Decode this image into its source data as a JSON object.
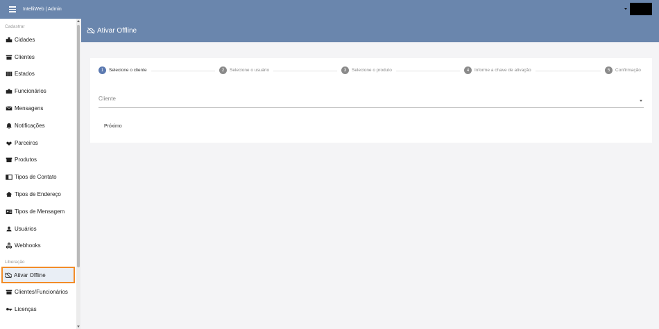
{
  "topbar": {
    "app_title": "IntelliWeb | Admin"
  },
  "sidebar": {
    "section_cadastrar": "Cadastrar",
    "items_cadastrar": [
      {
        "label": "Cidades",
        "icon": "city-icon"
      },
      {
        "label": "Clientes",
        "icon": "store-icon"
      },
      {
        "label": "Estados",
        "icon": "map-icon"
      },
      {
        "label": "Funcionários",
        "icon": "briefcase-icon"
      },
      {
        "label": "Mensagens",
        "icon": "mail-icon"
      },
      {
        "label": "Notificações",
        "icon": "bell-icon"
      },
      {
        "label": "Parceiros",
        "icon": "handshake-icon"
      },
      {
        "label": "Produtos",
        "icon": "box-icon"
      },
      {
        "label": "Tipos de Contato",
        "icon": "contact-icon"
      },
      {
        "label": "Tipos de Endereço",
        "icon": "home-icon"
      },
      {
        "label": "Tipos de Mensagem",
        "icon": "message-card-icon"
      },
      {
        "label": "Usuários",
        "icon": "user-icon"
      },
      {
        "label": "Webhooks",
        "icon": "webhook-icon"
      }
    ],
    "section_liberacao": "Liberação",
    "items_liberacao": [
      {
        "label": "Ativar Offline",
        "icon": "cloud-off-icon",
        "active": true
      },
      {
        "label": "Clientes/Funcionários",
        "icon": "store-icon"
      },
      {
        "label": "Licenças",
        "icon": "key-icon"
      }
    ]
  },
  "page": {
    "title": "Ativar Offline",
    "steps": [
      {
        "num": "1",
        "label": "Selecione o cliente",
        "active": true
      },
      {
        "num": "2",
        "label": "Selecione o usuário"
      },
      {
        "num": "3",
        "label": "Selecione o produto"
      },
      {
        "num": "4",
        "label": "Informe a chave de ativação"
      },
      {
        "num": "5",
        "label": "Confirmação"
      }
    ],
    "client_placeholder": "Cliente",
    "next_label": "Próximo"
  },
  "colors": {
    "header": "#6a86ad",
    "active_border": "#f28c28",
    "step_active": "#5b79b0"
  }
}
